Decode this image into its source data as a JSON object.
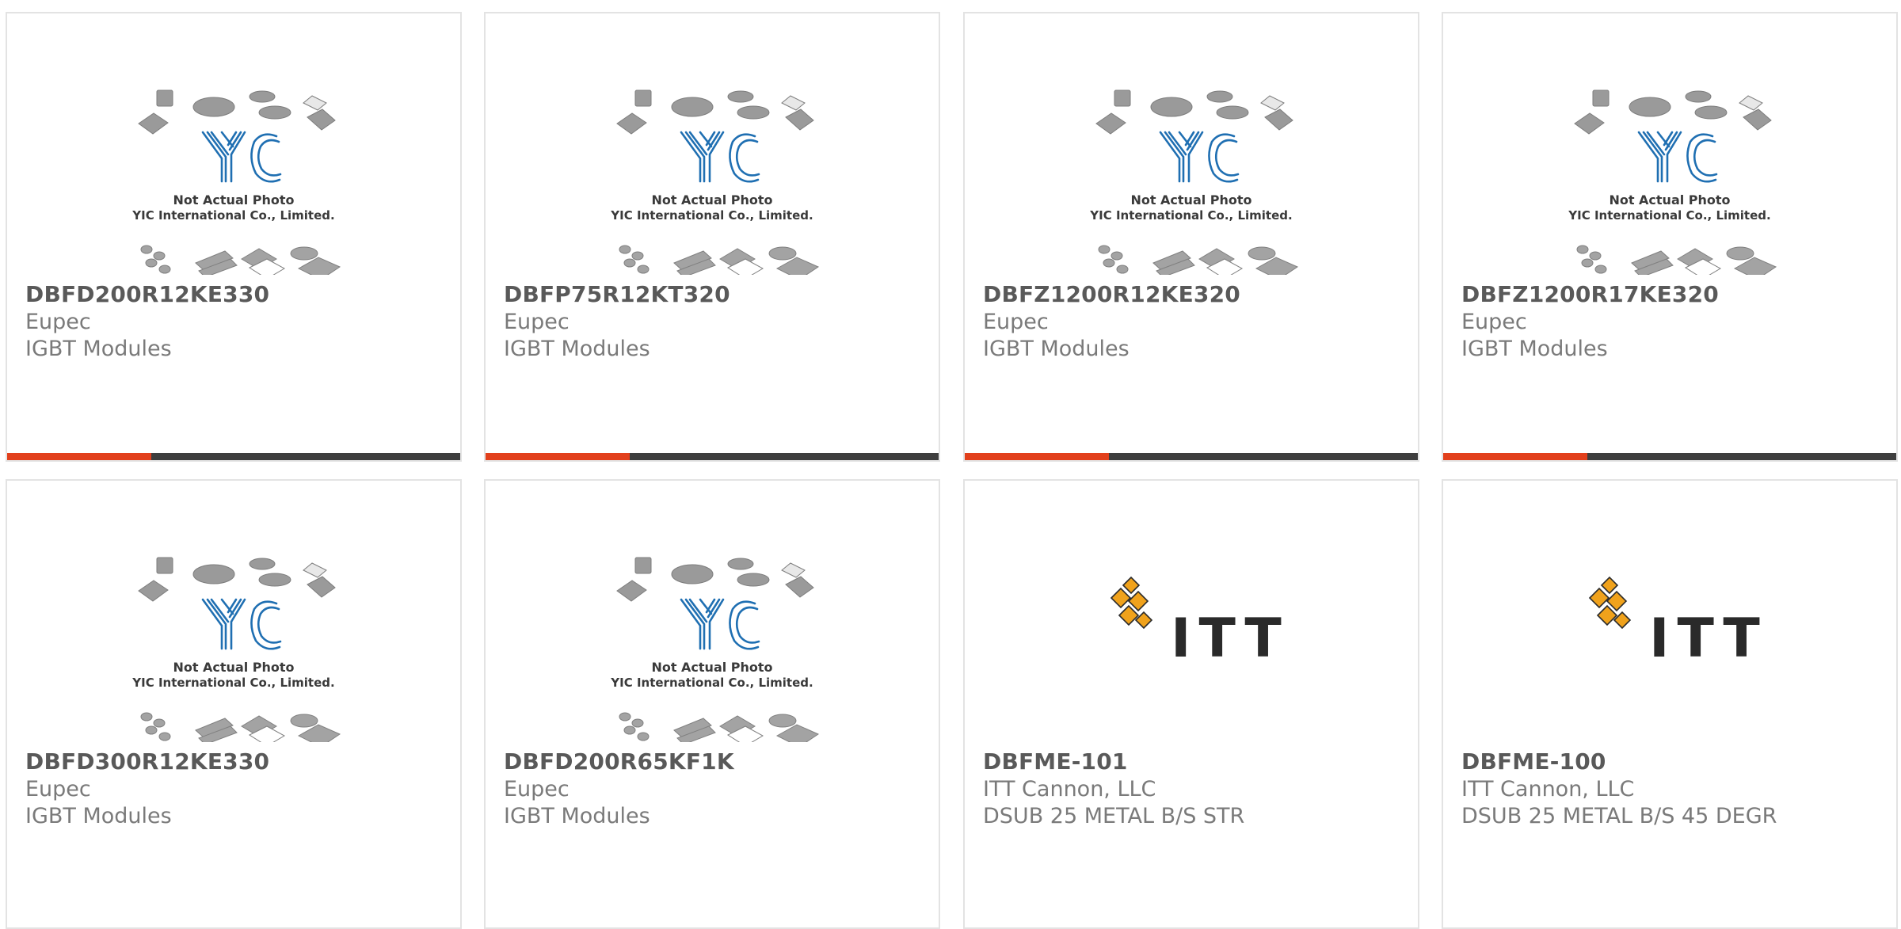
{
  "colors": {
    "accent": "#e2401c",
    "bar_dark": "#3e3e3e",
    "yic_blue": "#1f6fb2",
    "itt_orange": "#f0a21c",
    "text_bold": "#595959",
    "text_light": "#7a7a7a"
  },
  "placeholder": {
    "caption_line1": "Not Actual Photo",
    "caption_line2": "YIC International Co., Limited."
  },
  "itt_logo_text": "ITT",
  "products": [
    {
      "part": "DBFD200R12KE330",
      "manufacturer": "Eupec",
      "description": "IGBT Modules",
      "image": "yic-placeholder",
      "accent_bar": true
    },
    {
      "part": "DBFP75R12KT320",
      "manufacturer": "Eupec",
      "description": "IGBT Modules",
      "image": "yic-placeholder",
      "accent_bar": true
    },
    {
      "part": "DBFZ1200R12KE320",
      "manufacturer": "Eupec",
      "description": "IGBT Modules",
      "image": "yic-placeholder",
      "accent_bar": true
    },
    {
      "part": "DBFZ1200R17KE320",
      "manufacturer": "Eupec",
      "description": "IGBT Modules",
      "image": "yic-placeholder",
      "accent_bar": true
    },
    {
      "part": "DBFD300R12KE330",
      "manufacturer": "Eupec",
      "description": "IGBT Modules",
      "image": "yic-placeholder",
      "accent_bar": false
    },
    {
      "part": "DBFD200R65KF1K",
      "manufacturer": "Eupec",
      "description": "IGBT Modules",
      "image": "yic-placeholder",
      "accent_bar": false
    },
    {
      "part": "DBFME-101",
      "manufacturer": "ITT Cannon, LLC",
      "description": "DSUB 25 METAL B/S STR",
      "image": "itt-logo",
      "accent_bar": false
    },
    {
      "part": "DBFME-100",
      "manufacturer": "ITT Cannon, LLC",
      "description": "DSUB 25 METAL B/S 45 DEGR",
      "image": "itt-logo",
      "accent_bar": false
    }
  ]
}
